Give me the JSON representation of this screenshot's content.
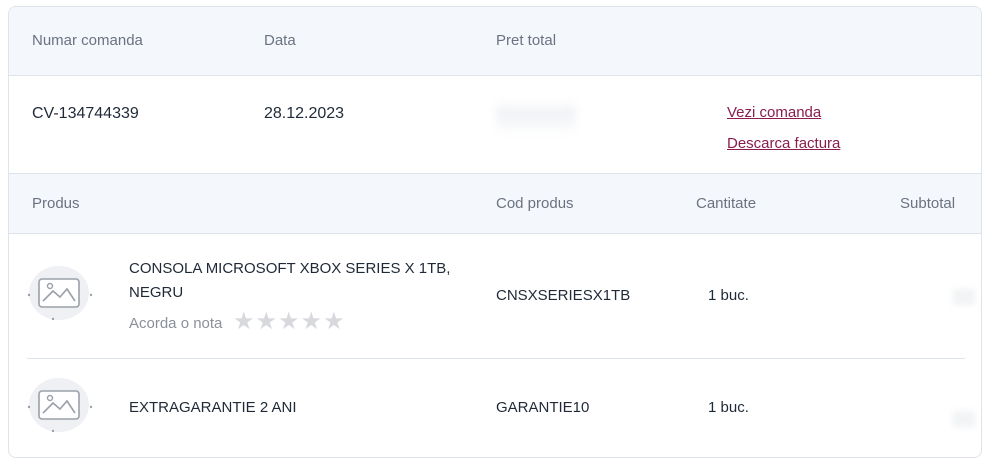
{
  "order_header": {
    "col_order": "Numar comanda",
    "col_date": "Data",
    "col_total": "Pret total"
  },
  "order": {
    "number": "CV-134744339",
    "date": "28.12.2023",
    "view_link": "Vezi comanda",
    "invoice_link": "Descarca factura"
  },
  "product_header": {
    "col_product": "Produs",
    "col_code": "Cod produs",
    "col_qty": "Cantitate",
    "col_subtotal": "Subtotal"
  },
  "products": [
    {
      "name": "CONSOLA MICROSOFT XBOX SERIES X 1TB, NEGRU",
      "code": "CNSXSERIESX1TB",
      "qty": "1 buc.",
      "rate_label": "Acorda o nota",
      "rating": 0
    },
    {
      "name": "EXTRAGARANTIE 2 ANI",
      "code": "GARANTIE10",
      "qty": "1 buc."
    }
  ],
  "icons": {
    "product_image": "image-placeholder-icon",
    "star": "star-icon"
  },
  "colors": {
    "link": "#8a1c4f",
    "header_bg": "#f4f7fc",
    "star_empty": "#d7d9dd"
  }
}
